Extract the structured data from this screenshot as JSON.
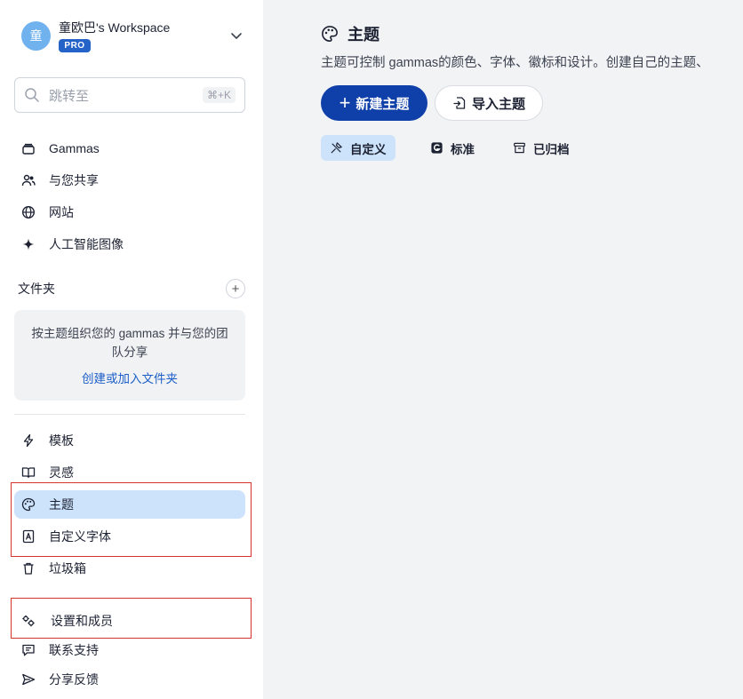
{
  "workspace": {
    "avatar_initial": "童",
    "name": "童欧巴's Workspace",
    "plan_badge": "PRO"
  },
  "search": {
    "placeholder": "跳转至",
    "shortcut": "⌘+K"
  },
  "nav_top": [
    {
      "label": "Gammas",
      "icon": "stack-icon"
    },
    {
      "label": "与您共享",
      "icon": "users-icon"
    },
    {
      "label": "网站",
      "icon": "globe-icon"
    },
    {
      "label": "人工智能图像",
      "icon": "sparkle-icon"
    }
  ],
  "folders": {
    "title": "文件夹",
    "add_label": "+",
    "empty_description": "按主题组织您的 gammas 并与您的团队分享",
    "create_link": "创建或加入文件夹"
  },
  "nav_bottom": [
    {
      "label": "模板",
      "icon": "bolt-icon"
    },
    {
      "label": "灵感",
      "icon": "book-icon"
    },
    {
      "label": "主题",
      "icon": "palette-icon",
      "active": true
    },
    {
      "label": "自定义字体",
      "icon": "font-icon"
    },
    {
      "label": "垃圾箱",
      "icon": "trash-icon"
    }
  ],
  "nav_footer": [
    {
      "label": "设置和成员",
      "icon": "gears-icon"
    },
    {
      "label": "联系支持",
      "icon": "chat-icon"
    },
    {
      "label": "分享反馈",
      "icon": "send-icon"
    }
  ],
  "main": {
    "title": "主题",
    "description": "主题可控制 gammas的颜色、字体、徽标和设计。创建自己的主题、",
    "new_theme_button": "新建主题",
    "import_theme_button": "导入主题",
    "tabs": [
      {
        "label": "自定义",
        "icon": "custom-brush-icon",
        "active": true
      },
      {
        "label": "标准",
        "icon": "gamma-logo-icon"
      },
      {
        "label": "已归档",
        "icon": "archive-icon"
      }
    ]
  },
  "colors": {
    "accent": "#0f3fa8",
    "active_bg": "#cde3fb",
    "highlight_box": "#d9342b"
  }
}
